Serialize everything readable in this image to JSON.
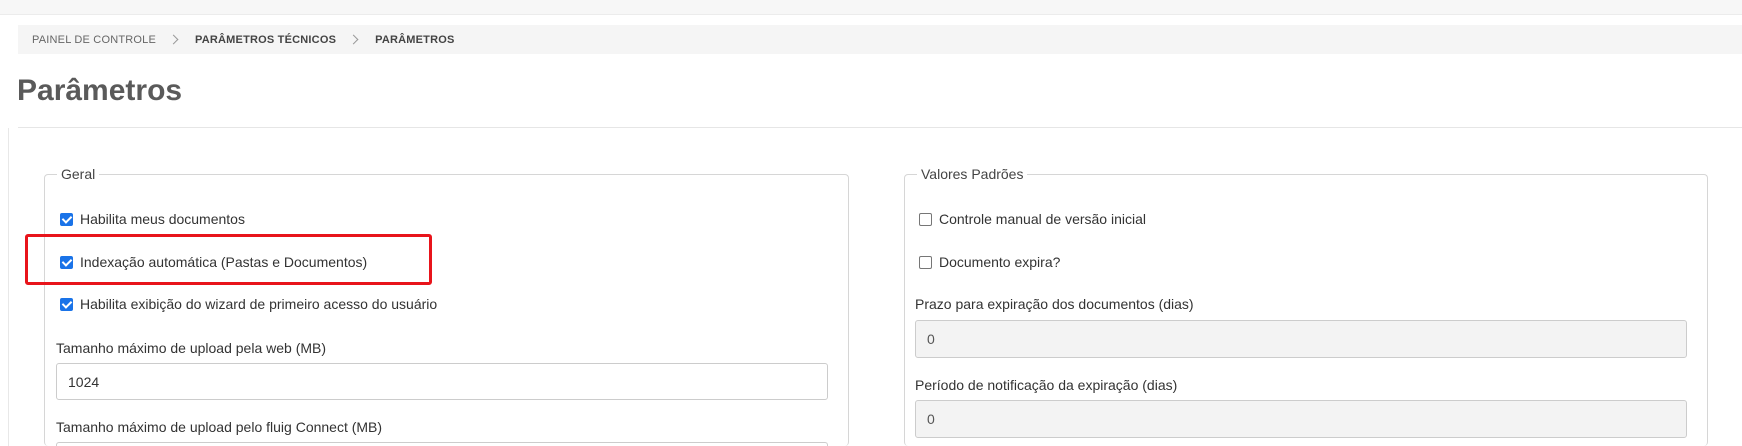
{
  "breadcrumb": {
    "items": [
      {
        "label": "PAINEL DE CONTROLE"
      },
      {
        "label": "PARÂMETROS TÉCNICOS"
      },
      {
        "label": "PARÂMETROS"
      }
    ]
  },
  "page": {
    "title": "Parâmetros"
  },
  "geral": {
    "legend": "Geral",
    "checkboxes": [
      {
        "label": "Habilita meus documentos",
        "checked": true
      },
      {
        "label": "Indexação automática (Pastas e Documentos)",
        "checked": true
      },
      {
        "label": "Habilita exibição do wizard de primeiro acesso do usuário",
        "checked": true
      }
    ],
    "upload_web": {
      "label": "Tamanho máximo de upload pela web (MB)",
      "value": "1024"
    },
    "upload_connect": {
      "label": "Tamanho máximo de upload pelo fluig Connect (MB)"
    }
  },
  "valores": {
    "legend": "Valores Padrões",
    "checkboxes": [
      {
        "label": "Controle manual de versão inicial",
        "checked": false
      },
      {
        "label": "Documento expira?",
        "checked": false
      }
    ],
    "prazo": {
      "label": "Prazo para expiração dos documentos (dias)",
      "value": "0"
    },
    "periodo": {
      "label": "Período de notificação da expiração (dias)",
      "value": "0"
    }
  },
  "colors": {
    "accent": "#1a73e8",
    "highlight": "#e8141b"
  }
}
